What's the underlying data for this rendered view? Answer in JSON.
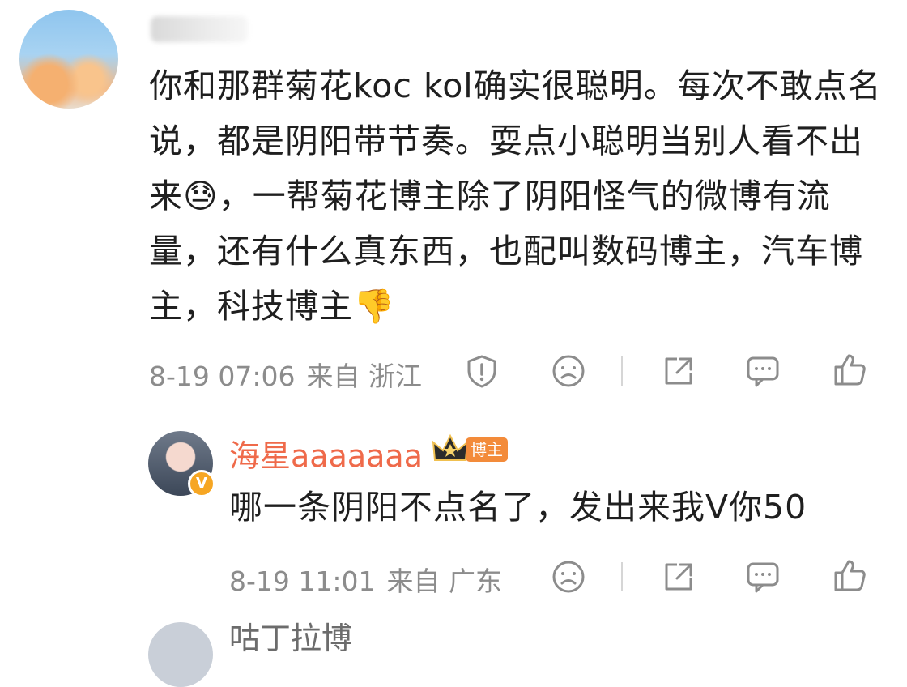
{
  "comment": {
    "username_display": "",
    "text": "你和那群菊花koc kol确实很聪明。每次不敢点名说，都是阴阳带节奏。耍点小聪明当别人看不出来😓，一帮菊花博主除了阴阳怪气的微博有流量，还有什么真东西，也配叫数码博主，汽车博主，科技博主👎",
    "date": "8-19 07:06",
    "source": "来自 浙江",
    "icons": [
      "report-icon",
      "dislike-face-icon",
      "share-icon",
      "comment-icon",
      "like-icon"
    ]
  },
  "reply": {
    "username": "海星aaaaaaa",
    "badge_label": "博主",
    "verified_mark": "V",
    "text": "哪一条阴阳不点名了，发出来我V你50",
    "date": "8-19 11:01",
    "source": "来自 广东",
    "icons": [
      "dislike-face-icon",
      "share-icon",
      "comment-icon",
      "like-icon"
    ]
  },
  "next_reply": {
    "username_partial": "咕丁拉博"
  },
  "colors": {
    "username_orange": "#ef6a4a",
    "badge_orange": "#f38b3a",
    "meta_gray": "#8c8c8c",
    "text": "#1f1f1f"
  }
}
